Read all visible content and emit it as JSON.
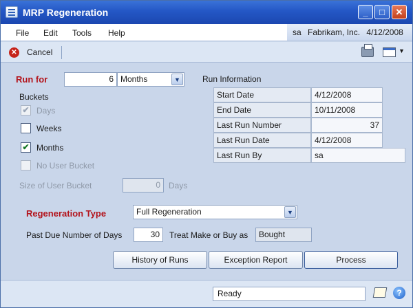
{
  "window": {
    "title": "MRP Regeneration",
    "minimize": "_",
    "maximize": "□",
    "close": "✕"
  },
  "menu": {
    "items": [
      "File",
      "Edit",
      "Tools",
      "Help"
    ],
    "user": "sa",
    "company": "Fabrikam, Inc.",
    "date": "4/12/2008"
  },
  "toolbar": {
    "cancel_label": "Cancel"
  },
  "run_for": {
    "label": "Run for",
    "value": "6",
    "unit": "Months"
  },
  "buckets": {
    "label": "Buckets",
    "items": [
      {
        "label": "Days",
        "checked": true,
        "enabled": false
      },
      {
        "label": "Weeks",
        "checked": false,
        "enabled": true
      },
      {
        "label": "Months",
        "checked": true,
        "enabled": true
      },
      {
        "label": "No User Bucket",
        "checked": false,
        "enabled": false
      }
    ],
    "size_label": "Size of User Bucket",
    "size_value": "0",
    "size_unit": "Days"
  },
  "run_info": {
    "heading": "Run Information",
    "rows": [
      {
        "label": "Start Date",
        "value": "4/12/2008"
      },
      {
        "label": "End Date",
        "value": "10/11/2008"
      },
      {
        "label": "Last Run Number",
        "value": "37"
      },
      {
        "label": "Last Run Date",
        "value": "4/12/2008"
      },
      {
        "label": "Last Run By",
        "value": "sa"
      }
    ]
  },
  "regeneration": {
    "label": "Regeneration Type",
    "value": "Full Regeneration"
  },
  "past_due": {
    "label": "Past Due Number of Days",
    "value": "30"
  },
  "make_or_buy": {
    "label": "Treat Make or Buy as",
    "value": "Bought"
  },
  "buttons": {
    "history": "History of Runs",
    "exception": "Exception  Report",
    "process": "Process"
  },
  "status": {
    "text": "Ready"
  },
  "icons": {
    "cancel": "cancel-icon",
    "printer": "printer-icon",
    "window": "window-layout-icon",
    "note": "note-icon",
    "help": "help-icon"
  }
}
